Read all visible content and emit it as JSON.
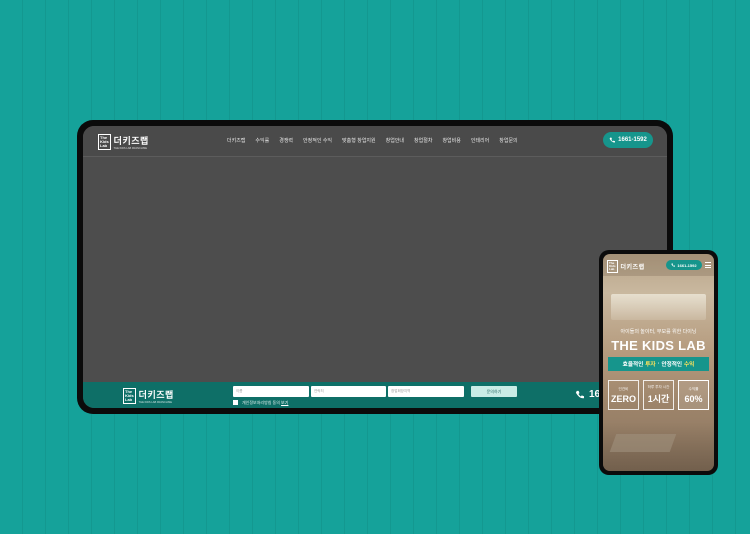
{
  "desktop": {
    "logo": {
      "mark": "The\nKids\nLab",
      "name": "더키즈랩",
      "sub": "THE KIDS LAB FRANCHISE"
    },
    "nav": [
      "더키즈랩",
      "수익률",
      "경쟁력",
      "안정적인 수익",
      "맞춤형 창업지원",
      "창업안내",
      "창업절차",
      "창업비용",
      "인테리어",
      "창업문의"
    ],
    "phone": "1661-1592",
    "footer": {
      "logo_name": "더키즈랩",
      "logo_sub": "THE KIDS LAB FRANCHISE",
      "name_placeholder": "이름",
      "contact_placeholder": "연락처",
      "region_placeholder": "창업희망지역",
      "submit": "문의하기",
      "agree_text": "개인정보처리방침 동의",
      "agree_link": "보기",
      "phone": "166"
    }
  },
  "mobile": {
    "logo_name": "더키즈랩",
    "phone": "1661-1592",
    "tagline": "아이들의 놀이터, 부모를 위한 다이닝",
    "title": "THE KIDS LAB",
    "band": {
      "part1": "효율적인",
      "part1_hl": "투자",
      "separator": "·",
      "part2": "안정적인",
      "part2_hl": "수익"
    },
    "stats": [
      {
        "label": "인건비",
        "value": "ZERO"
      },
      {
        "label": "하루 투자 시간",
        "value": "1시간"
      },
      {
        "label": "수익률",
        "value": "60%"
      }
    ]
  },
  "colors": {
    "background": "#15a29a",
    "accent": "#16958c",
    "footer": "#0e6f67",
    "highlight": "#ffe25a"
  }
}
